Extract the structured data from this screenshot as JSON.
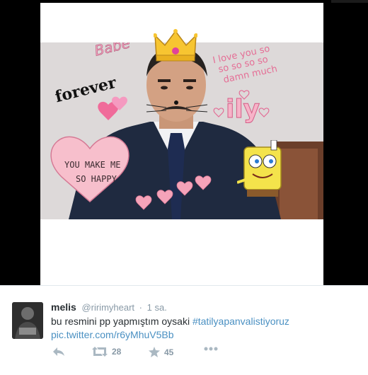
{
  "photo": {
    "stickers": {
      "babe": "Babe",
      "forever": "forever",
      "love_line1": "I love you so",
      "love_line2": "so so so so",
      "love_line3": "damn much",
      "ily": "ily",
      "heart_line1": "YOU MAKE ME",
      "heart_line2": "SO HAPPY"
    }
  },
  "tweet": {
    "name": "melis",
    "handle": "@ririmyheart",
    "separator": "·",
    "time": "1 sa.",
    "text": "bu resmini pp yapmıştım oysaki",
    "hashtag": "#tatilyapanvalistiyoruz",
    "link": "pic.twitter.com/r6yMhuV5Bb",
    "retweet_count": "28",
    "favorite_count": "45"
  },
  "icons": [
    "reply-icon",
    "retweet-icon",
    "favorite-icon",
    "more-icon",
    "crown-icon",
    "heart-icon",
    "spongebob-sticker"
  ],
  "colors": {
    "link": "#4a90c2",
    "text": "#292f33",
    "muted": "#8899a6",
    "sticker_pink": "#f27fa5"
  }
}
